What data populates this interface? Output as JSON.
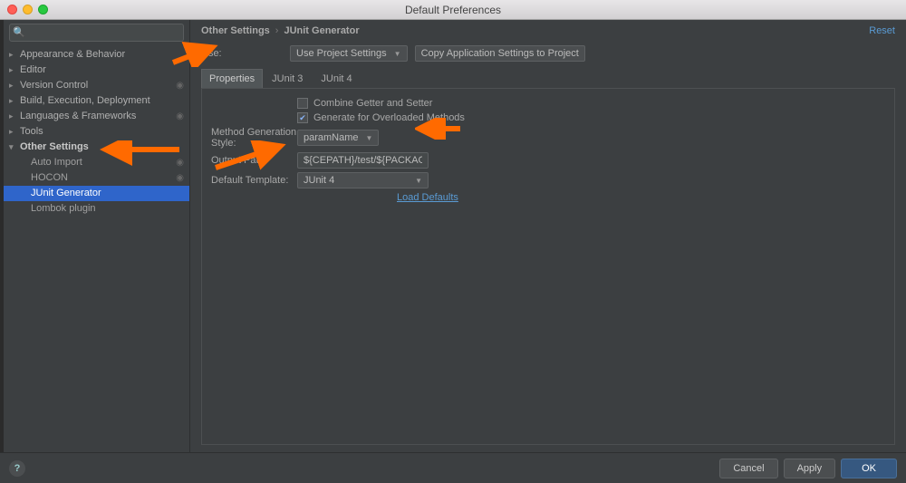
{
  "window": {
    "title": "Default Preferences"
  },
  "search": {
    "placeholder": ""
  },
  "sidebar": {
    "items": [
      {
        "label": "Appearance & Behavior",
        "expandable": true
      },
      {
        "label": "Editor",
        "expandable": true
      },
      {
        "label": "Version Control",
        "expandable": true,
        "gear": true
      },
      {
        "label": "Build, Execution, Deployment",
        "expandable": true
      },
      {
        "label": "Languages & Frameworks",
        "expandable": true,
        "gear": true
      },
      {
        "label": "Tools",
        "expandable": true
      },
      {
        "label": "Other Settings",
        "expandable": true,
        "expanded": true,
        "bold": true
      }
    ],
    "children": [
      {
        "label": "Auto Import",
        "gear": true
      },
      {
        "label": "HOCON",
        "gear": true
      },
      {
        "label": "JUnit Generator",
        "selected": true
      },
      {
        "label": "Lombok plugin"
      }
    ]
  },
  "breadcrumb": {
    "a": "Other Settings",
    "b": "JUnit Generator"
  },
  "reset_label": "Reset",
  "form": {
    "use_label": "Use:",
    "use_value": "Use Project Settings",
    "copy_button": "Copy Application Settings to Project",
    "tabs": {
      "label": "Properties",
      "t1": "JUnit 3",
      "t2": "JUnit 4"
    },
    "combine_label": "Combine Getter and Setter",
    "generate_label": "Generate for Overloaded Methods",
    "method_gen_label": "Method Generation Style:",
    "method_gen_value": "paramName",
    "output_label": "Output Path:",
    "output_value": "${CEPATH}/test/${PACKAGE}/${FILENAME}",
    "template_label": "Default Template:",
    "template_value": "JUnit 4",
    "load_defaults": "Load Defaults"
  },
  "footer": {
    "cancel": "Cancel",
    "apply": "Apply",
    "ok": "OK"
  }
}
